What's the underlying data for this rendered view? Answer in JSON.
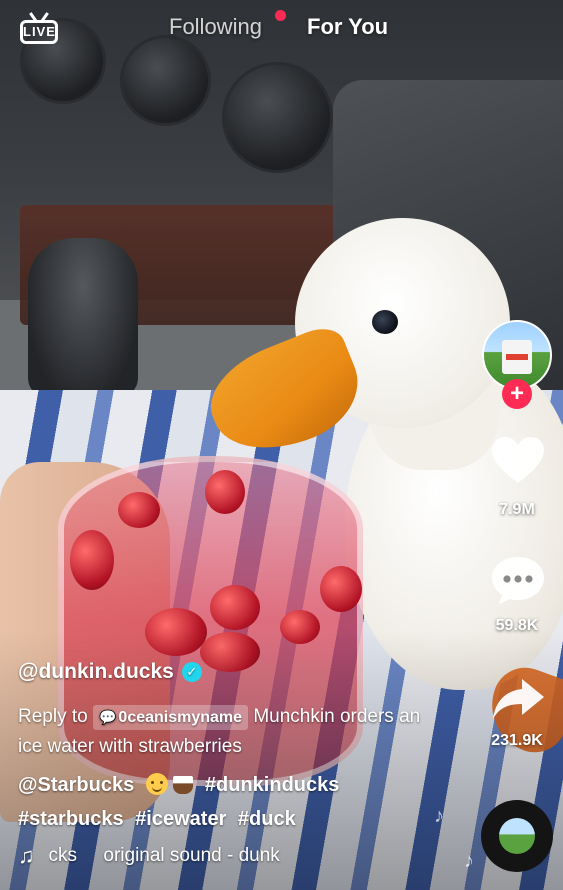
{
  "nav": {
    "live_label": "LIVE",
    "tab_following": "Following",
    "tab_for_you": "For You",
    "active_tab": "For You",
    "notify_dot_color": "#fe2c55"
  },
  "rail": {
    "follow_symbol": "+",
    "likes": "7.9M",
    "comments": "59.8K",
    "shares": "231.9K"
  },
  "post": {
    "username": "@dunkin.ducks",
    "verified_mark": "✓",
    "reply_prefix": "Reply to",
    "reply_user": "0ceanismyname",
    "desc_text": "Munchkin orders an ice water with strawberries",
    "mention": "@Starbucks",
    "hashtags": [
      "#dunkinducks",
      "#starbucks",
      "#icewater",
      "#duck"
    ],
    "sound": "cks     original sound - dunk"
  },
  "icons": {
    "live": "live-tv-icon",
    "like": "heart-icon",
    "comment": "comment-bubble-icon",
    "share": "share-arrow-icon",
    "music": "music-note-icon",
    "sound_disc": "sound-disc-icon"
  },
  "colors": {
    "accent": "#fe2c55",
    "verified": "#20d5ec"
  }
}
